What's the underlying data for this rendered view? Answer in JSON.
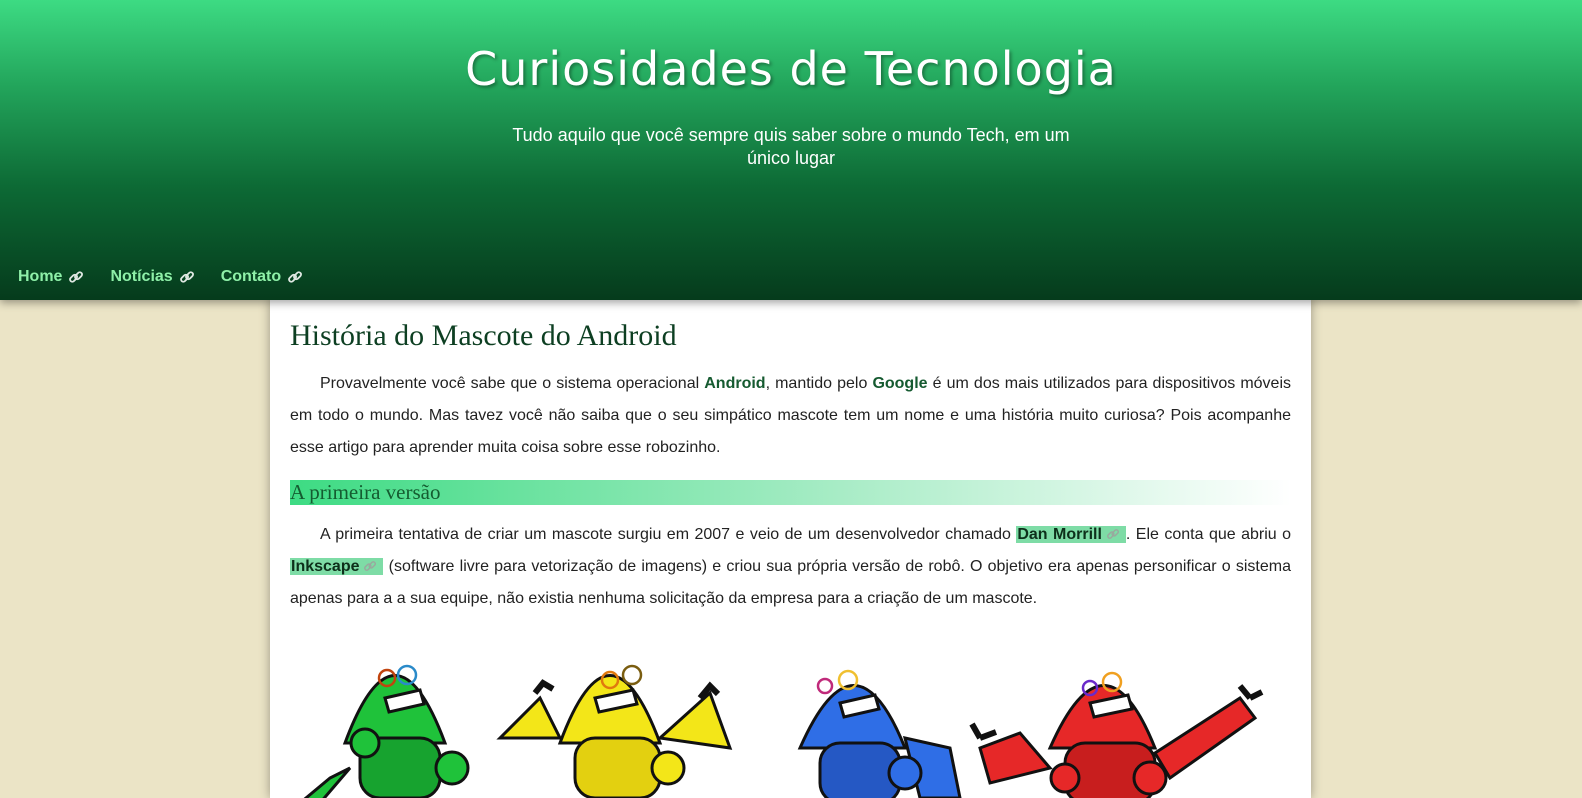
{
  "header": {
    "title": "Curiosidades de Tecnologia",
    "subtitle": "Tudo aquilo que você sempre quis saber sobre o mundo Tech, em um único lugar"
  },
  "nav": {
    "items": [
      {
        "label": "Home",
        "icon": "link-icon"
      },
      {
        "label": "Notícias",
        "icon": "link-icon"
      },
      {
        "label": "Contato",
        "icon": "link-icon"
      }
    ]
  },
  "article": {
    "title": "História do Mascote do Android",
    "intro": {
      "part1": "Provavelmente você sabe que o sistema operacional ",
      "android": "Android",
      "part2": ", mantido pelo ",
      "google": "Google",
      "part3": " é um dos mais utilizados para dispositivos móveis em todo o mundo. Mas tavez você não saiba que o seu simpático mascote tem um nome e uma história muito curiosa? Pois acompanhe esse artigo para aprender muita coisa sobre esse robozinho."
    },
    "section1": {
      "heading": "A primeira versão",
      "part1": "A primeira tentativa de criar um mascote surgiu em 2007 e veio de um desenvolvedor chamado ",
      "link1": "Dan Morrill",
      "part2": ". Ele conta que abriu o ",
      "link2": "Inkscape",
      "part3": " (software livre para vetorização de imagens) e criou sua própria versão de robô. O objetivo era apenas personificar o sistema apenas para a a sua equipe, não existia nenhuma solicitação da empresa para a criação de um mascote."
    },
    "image": {
      "robots": [
        {
          "color": "#1fc23a",
          "icon": "robot-green"
        },
        {
          "color": "#f3e618",
          "icon": "robot-yellow"
        },
        {
          "color": "#2f6ee6",
          "icon": "robot-blue"
        },
        {
          "color": "#e62828",
          "icon": "robot-red"
        }
      ]
    }
  },
  "colors": {
    "header_top": "#3ddb83",
    "header_bottom": "#053b1c",
    "page_bg": "#ebe4c6",
    "nav_text": "#8ef0a8",
    "link_highlight": "#7edca6"
  }
}
